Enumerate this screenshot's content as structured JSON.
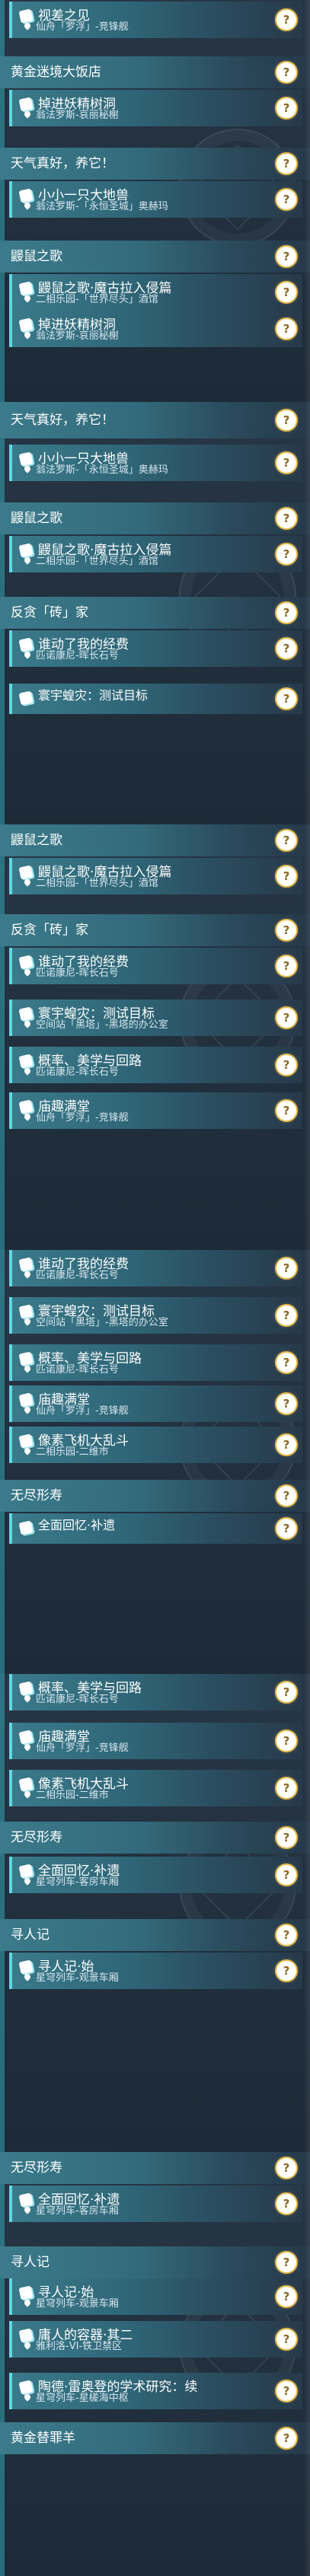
{
  "strips": [
    {
      "rows": [
        {
          "kind": "quest",
          "title": "视差之见",
          "loc": "仙舟「罗浮」-竞锋舰"
        },
        {
          "kind": "group",
          "title": "黄金迷境大饭店"
        },
        {
          "kind": "quest",
          "title": "掉进妖精树洞",
          "loc": "翁法罗斯-哀丽秘榭"
        },
        {
          "kind": "group",
          "title": "天气真好，养它！"
        },
        {
          "kind": "quest",
          "title": "小小一只大地兽",
          "loc": "翁法罗斯-「永恒圣城」奥赫玛"
        },
        {
          "kind": "group",
          "title": "鼹鼠之歌"
        },
        {
          "kind": "quest",
          "title": "鼹鼠之歌·魔古拉入侵篇",
          "loc": "二相乐园-「世界尽头」酒馆"
        },
        {
          "kind": "quest",
          "title": "掉进妖精树洞",
          "loc": "翁法罗斯-哀丽秘榭"
        }
      ]
    },
    {
      "rows": [
        {
          "kind": "group",
          "title": "天气真好，养它！"
        },
        {
          "kind": "quest",
          "title": "小小一只大地兽",
          "loc": "翁法罗斯-「永恒圣城」奥赫玛"
        },
        {
          "kind": "group",
          "title": "鼹鼠之歌"
        },
        {
          "kind": "quest",
          "title": "鼹鼠之歌·魔古拉入侵篇",
          "loc": "二相乐园-「世界尽头」酒馆"
        },
        {
          "kind": "group",
          "title": "反贪「砖」家"
        },
        {
          "kind": "quest",
          "title": "谁动了我的经费",
          "loc": "匹诺康尼-晖长石号"
        },
        {
          "kind": "quest",
          "title": "寰宇蝗灾：测试目标",
          "loc": ""
        }
      ]
    },
    {
      "rows": [
        {
          "kind": "group",
          "title": "鼹鼠之歌"
        },
        {
          "kind": "quest",
          "title": "鼹鼠之歌·魔古拉入侵篇",
          "loc": "二相乐园-「世界尽头」酒馆"
        },
        {
          "kind": "group",
          "title": "反贪「砖」家"
        },
        {
          "kind": "quest",
          "title": "谁动了我的经费",
          "loc": "匹诺康尼-晖长石号"
        },
        {
          "kind": "quest",
          "title": "寰宇蝗灾：测试目标",
          "loc": "空间站「黑塔」-黑塔的办公室"
        },
        {
          "kind": "quest",
          "title": "概率、美学与回路",
          "loc": "匹诺康尼-晖长石号"
        },
        {
          "kind": "quest",
          "title": "庙趣满堂",
          "loc": "仙舟「罗浮」-竞锋舰"
        }
      ]
    },
    {
      "rows": [
        {
          "kind": "quest",
          "title": "谁动了我的经费",
          "loc": "匹诺康尼-晖长石号"
        },
        {
          "kind": "quest",
          "title": "寰宇蝗灾：测试目标",
          "loc": "空间站「黑塔」-黑塔的办公室"
        },
        {
          "kind": "quest",
          "title": "概率、美学与回路",
          "loc": "匹诺康尼-晖长石号"
        },
        {
          "kind": "quest",
          "title": "庙趣满堂",
          "loc": "仙舟「罗浮」-竞锋舰"
        },
        {
          "kind": "quest",
          "title": "像素飞机大乱斗",
          "loc": "二相乐园-二维市"
        },
        {
          "kind": "group",
          "title": "无尽形寿"
        },
        {
          "kind": "quest",
          "title": "全面回忆·补遗",
          "loc": ""
        }
      ]
    },
    {
      "rows": [
        {
          "kind": "quest",
          "title": "概率、美学与回路",
          "loc": "匹诺康尼-晖长石号"
        },
        {
          "kind": "quest",
          "title": "庙趣满堂",
          "loc": "仙舟「罗浮」-竞锋舰"
        },
        {
          "kind": "quest",
          "title": "像素飞机大乱斗",
          "loc": "二相乐园-二维市"
        },
        {
          "kind": "group",
          "title": "无尽形寿"
        },
        {
          "kind": "quest",
          "title": "全面回忆·补遗",
          "loc": "星穹列车-客房车厢"
        },
        {
          "kind": "group",
          "title": "寻人记"
        },
        {
          "kind": "quest",
          "title": "寻人记·始",
          "loc": "星穹列车-观景车厢"
        }
      ]
    },
    {
      "rows": [
        {
          "kind": "group",
          "title": "无尽形寿"
        },
        {
          "kind": "quest",
          "title": "全面回忆·补遗",
          "loc": "星穹列车-客房车厢"
        },
        {
          "kind": "group",
          "title": "寻人记"
        },
        {
          "kind": "quest",
          "title": "寻人记·始",
          "loc": "星穹列车-观景车厢"
        },
        {
          "kind": "quest",
          "title": "庸人的容器·其二",
          "loc": "雅利洛-VI-铁卫禁区"
        },
        {
          "kind": "quest",
          "title": "陶德·雷奥登的学术研究：续",
          "loc": "星穹列车-星槎海中枢"
        },
        {
          "kind": "group",
          "title": "黄金替罪羊"
        }
      ]
    }
  ],
  "badge_glyph": "?",
  "icons": {
    "quest": "quest-scroll-icon",
    "location": "map-pin-icon",
    "badge": "exclamation-badge-icon"
  }
}
